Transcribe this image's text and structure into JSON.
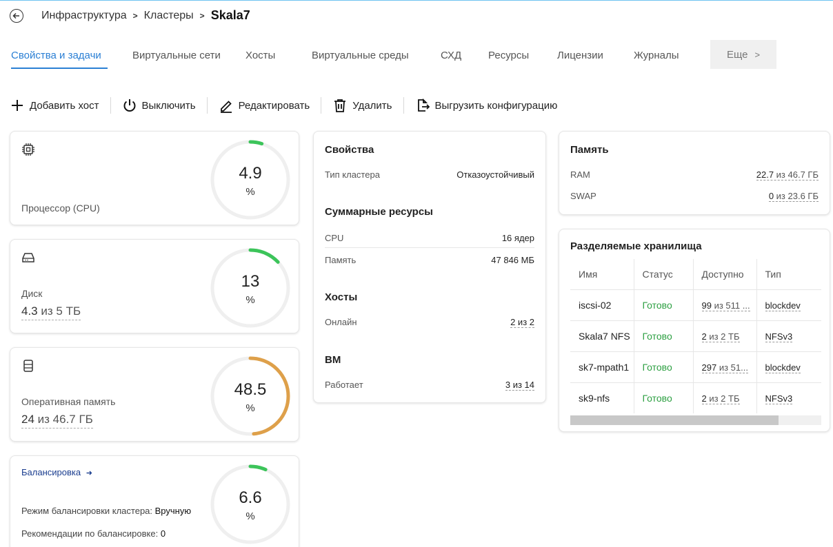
{
  "breadcrumb": {
    "items": [
      "Инфраструктура",
      "Кластеры"
    ],
    "current": "Skala7"
  },
  "tabs": [
    {
      "label": "Свойства и задачи",
      "active": true
    },
    {
      "label": "Виртуальные сети"
    },
    {
      "label": "Хосты"
    },
    {
      "label": "Виртуальные среды"
    },
    {
      "label": "СХД"
    },
    {
      "label": "Ресурсы"
    },
    {
      "label": "Лицензии"
    },
    {
      "label": "Журналы"
    }
  ],
  "more_tab": "Еще",
  "toolbar": {
    "add_host": "Добавить хост",
    "power_off": "Выключить",
    "edit": "Редактировать",
    "delete": "Удалить",
    "export": "Выгрузить конфигурацию"
  },
  "cpu": {
    "title": "Процессор (CPU)",
    "value": "4.9",
    "unit": "%",
    "fraction": 0.049,
    "color": "#3cc45a",
    "icon": "cpu-icon"
  },
  "disk": {
    "title": "Диск",
    "used": "4.3",
    "of": "из 5 ТБ",
    "value": "13",
    "unit": "%",
    "fraction": 0.13,
    "color": "#3cc45a",
    "icon": "disk-icon"
  },
  "ram": {
    "title": "Оперативная память",
    "used": "24",
    "of": "из 46.7 ГБ",
    "value": "48.5",
    "unit": "%",
    "fraction": 0.485,
    "color": "#dea04a",
    "icon": "memory-icon"
  },
  "balancing": {
    "link": "Балансировка",
    "mode_label": "Режим балансировки кластера:",
    "mode_value": "Вручную",
    "rec_label": "Рекомендации по балансировке:",
    "rec_value": "0",
    "value": "6.6",
    "unit": "%",
    "fraction": 0.066,
    "color": "#3cc45a"
  },
  "props": {
    "title": "Свойства",
    "cluster_type_label": "Тип кластера",
    "cluster_type_value": "Отказоустойчивый",
    "resources_title": "Суммарные ресурсы",
    "cpu_label": "CPU",
    "cpu_value": "16 ядер",
    "mem_label": "Память",
    "mem_value": "47 846 МБ",
    "hosts_title": "Хосты",
    "online_label": "Онлайн",
    "online_value": "2 из 2",
    "vm_title": "ВМ",
    "running_label": "Работает",
    "running_value": "3 из 14"
  },
  "memory": {
    "title": "Память",
    "ram_label": "RAM",
    "ram_used": "22.7",
    "ram_total": " из 46.7 ГБ",
    "swap_label": "SWAP",
    "swap_used": "0",
    "swap_total": " из 23.6 ГБ"
  },
  "storage": {
    "title": "Разделяемые хранилища",
    "columns": [
      "Имя",
      "Статус",
      "Доступно",
      "Тип"
    ],
    "rows": [
      {
        "name": "iscsi-02",
        "status": "Готово",
        "avail_used": "99",
        "avail_rest": " из 511 ...",
        "type": "blockdev"
      },
      {
        "name": "Skala7 NFS",
        "status": "Готово",
        "avail_used": "2",
        "avail_rest": " из 2 ТБ",
        "type": "NFSv3"
      },
      {
        "name": "sk7-mpath1",
        "status": "Готово",
        "avail_used": "297",
        "avail_rest": " из 51...",
        "type": "blockdev"
      },
      {
        "name": "sk9-nfs",
        "status": "Готово",
        "avail_used": "2",
        "avail_rest": " из 2 ТБ",
        "type": "NFSv3"
      }
    ]
  }
}
